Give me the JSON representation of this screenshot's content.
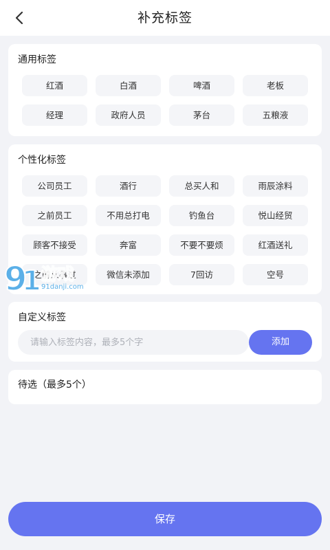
{
  "header": {
    "title": "补充标签"
  },
  "common": {
    "title": "通用标签",
    "tags": [
      "红酒",
      "白酒",
      "啤酒",
      "老板",
      "经理",
      "政府人员",
      "茅台",
      "五粮液"
    ]
  },
  "personal": {
    "title": "个性化标签",
    "tags": [
      "公司员工",
      "酒行",
      "总买人和",
      "雨辰涂料",
      "之前员工",
      "不用总打电",
      "钓鱼台",
      "悦山经贸",
      "顾客不接受",
      "奔富",
      "不要不要烦",
      "红酒送礼",
      "之前从事过",
      "微信未添加",
      "7回访",
      "空号"
    ]
  },
  "custom": {
    "title": "自定义标签",
    "placeholder": "请输入标签内容，最多5个字",
    "value": "",
    "add_label": "添加"
  },
  "pending": {
    "title": "待选（最多5个）"
  },
  "footer": {
    "save_label": "保存"
  },
  "watermark": {
    "text_big": "9",
    "text_word": "游戏",
    "text_url": "91danji.com"
  },
  "colors": {
    "accent": "#6574f0",
    "background": "#f2f3f7",
    "tag_bg": "#f4f5f8"
  }
}
